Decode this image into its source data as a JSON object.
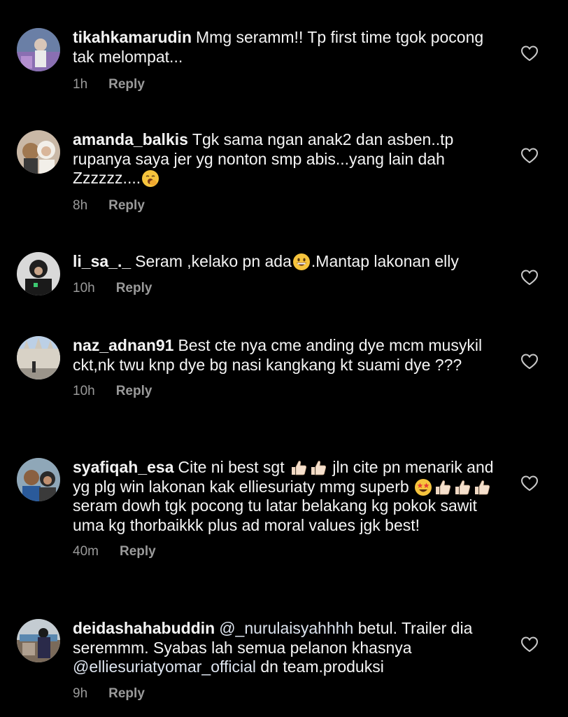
{
  "comments": [
    {
      "username": "tikahkamarudin",
      "segments": [
        {
          "t": "Mmg seramm!! Tp first time tgok pocong tak melompat..."
        }
      ],
      "time": "1h",
      "reply": "Reply",
      "avatar": "avatar-photo-icon"
    },
    {
      "username": "amanda_balkis",
      "segments": [
        {
          "t": "Tgk sama ngan anak2 dan asben..tp rupanya saya jer yg nonton smp abis...yang lain dah Zzzzzz...."
        },
        {
          "emoji": "yawning-face-emoji"
        }
      ],
      "time": "8h",
      "reply": "Reply",
      "avatar": "avatar-photo-icon"
    },
    {
      "username": "li_sa_._",
      "segments": [
        {
          "t": "Seram ,kelako pn ada"
        },
        {
          "emoji": "grinning-face-emoji"
        },
        {
          "t": ".Mantap lakonan elly"
        }
      ],
      "time": "10h",
      "reply": "Reply",
      "avatar": "avatar-photo-icon"
    },
    {
      "username": "naz_adnan91",
      "segments": [
        {
          "t": "Best cte nya cme anding dye mcm musykil ckt,nk twu knp dye bg nasi kangkang kt suami dye ???"
        }
      ],
      "time": "10h",
      "reply": "Reply",
      "avatar": "avatar-photo-icon"
    },
    {
      "username": "syafiqah_esa",
      "segments": [
        {
          "t": "Cite ni best sgt "
        },
        {
          "emoji": "thumbs-up-emoji"
        },
        {
          "emoji": "thumbs-up-emoji"
        },
        {
          "t": " jln cite pn menarik and yg plg win lakonan kak elliesuriaty mmg superb "
        },
        {
          "emoji": "star-struck-emoji"
        },
        {
          "emoji": "thumbs-up-emoji"
        },
        {
          "emoji": "thumbs-up-emoji"
        },
        {
          "emoji": "thumbs-up-emoji"
        },
        {
          "t": " seram dowh tgk pocong tu latar belakang kg pokok sawit uma kg thorbaikkk plus ad moral values jgk best!"
        }
      ],
      "time": "40m",
      "reply": "Reply",
      "avatar": "avatar-photo-icon"
    },
    {
      "username": "deidashahabuddin",
      "segments": [
        {
          "m": "@_nurulaisyahhhh"
        },
        {
          "t": " betul. Trailer dia seremmm. Syabas lah semua pelanon khasnya "
        },
        {
          "m": "@elliesuriatyomar_official"
        },
        {
          "t": "  dn team.produksi"
        }
      ],
      "time": "9h",
      "reply": "Reply",
      "avatar": "avatar-photo-icon"
    }
  ],
  "colors": {
    "background": "#000000",
    "text": "#f5f5f5",
    "meta": "#9a9a9a"
  },
  "like_icon": "heart-outline-icon"
}
